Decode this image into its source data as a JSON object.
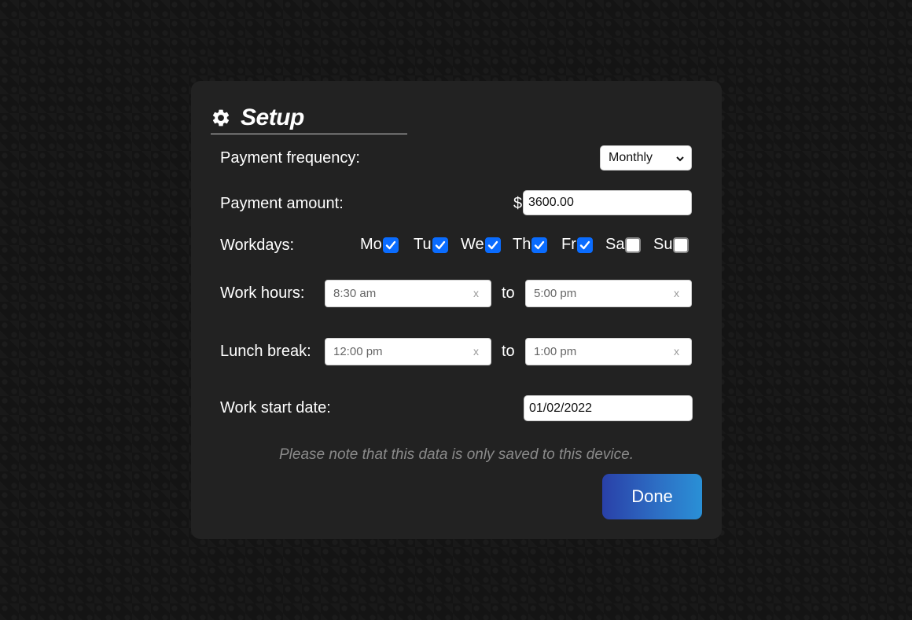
{
  "setup": {
    "title": "Setup",
    "icon": "gear-icon"
  },
  "payment_frequency": {
    "label": "Payment frequency:",
    "selected": "Monthly"
  },
  "payment_amount": {
    "label": "Payment amount:",
    "currency": "$",
    "value": "3600.00"
  },
  "workdays": {
    "label": "Workdays:",
    "days": [
      {
        "label": "Mo",
        "checked": true
      },
      {
        "label": "Tu",
        "checked": true
      },
      {
        "label": "We",
        "checked": true
      },
      {
        "label": "Th",
        "checked": true
      },
      {
        "label": "Fr",
        "checked": true
      },
      {
        "label": "Sa",
        "checked": false
      },
      {
        "label": "Su",
        "checked": false
      }
    ]
  },
  "work_hours": {
    "label": "Work hours:",
    "from": "8:30 am",
    "to_label": "to",
    "to": "5:00 pm",
    "clear": "x"
  },
  "lunch_break": {
    "label": "Lunch break:",
    "from": "12:00 pm",
    "to_label": "to",
    "to": "1:00 pm",
    "clear": "x"
  },
  "work_start_date": {
    "label": "Work start date:",
    "value": "01/02/2022"
  },
  "note": "Please note that this data is only saved to this device.",
  "done_label": "Done",
  "colors": {
    "panel": "#222222",
    "checkbox_on": "#0a6cff",
    "button_start": "#2940a8",
    "button_end": "#2a90d6"
  }
}
